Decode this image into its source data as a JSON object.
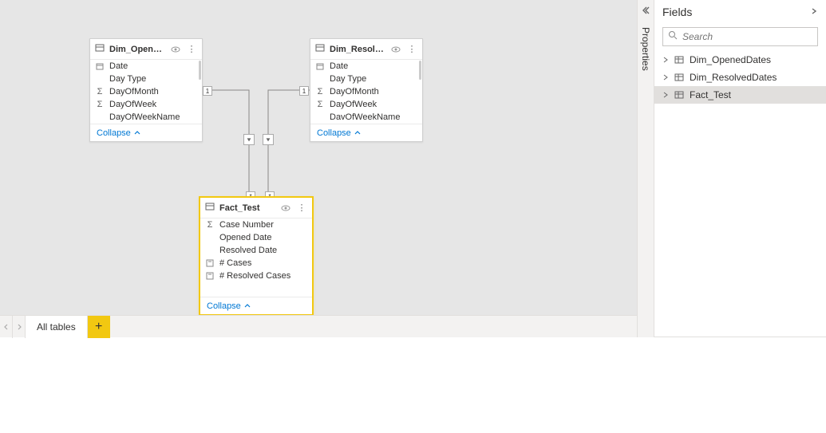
{
  "canvas": {
    "tables": {
      "dim_opened": {
        "title": "Dim_OpenedDates",
        "collapse": "Collapse",
        "fields": [
          "Date",
          "Day Type",
          "DayOfMonth",
          "DayOfWeek",
          "DayOfWeekName"
        ]
      },
      "dim_resolved": {
        "title": "Dim_ResolvedDates",
        "collapse": "Collapse",
        "fields": [
          "Date",
          "Day Type",
          "DayOfMonth",
          "DayOfWeek",
          "DavOfWeekName"
        ]
      },
      "fact_test": {
        "title": "Fact_Test",
        "collapse": "Collapse",
        "fields": [
          "Case Number",
          "Opened Date",
          "Resolved Date",
          "# Cases",
          "# Resolved Cases"
        ]
      }
    },
    "relations": {
      "one": "1",
      "many": "*"
    }
  },
  "footer": {
    "tab": "All tables",
    "add": "+"
  },
  "rail": {
    "label": "Properties"
  },
  "fields_pane": {
    "title": "Fields",
    "search_placeholder": "Search",
    "items": [
      "Dim_OpenedDates",
      "Dim_ResolvedDates",
      "Fact_Test"
    ]
  }
}
